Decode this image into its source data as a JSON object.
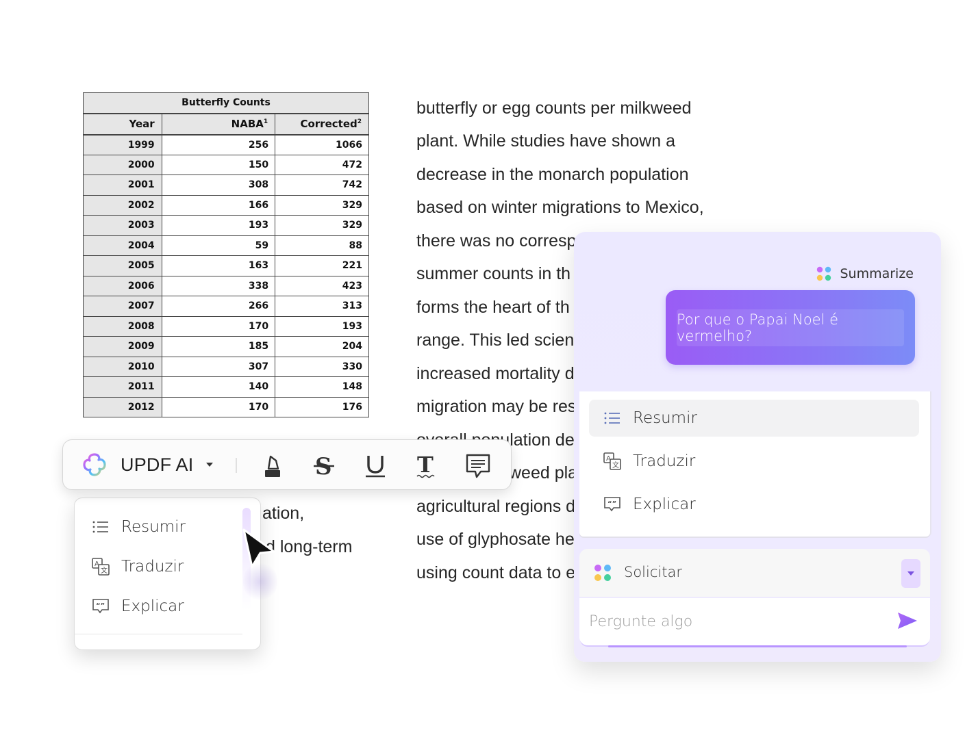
{
  "table": {
    "title": "Butterfly Counts",
    "headers": [
      "Year",
      "NABA",
      "Corrected"
    ],
    "header_sups": [
      "",
      "1",
      "2"
    ],
    "rows": [
      [
        "1999",
        "256",
        "1066"
      ],
      [
        "2000",
        "150",
        "472"
      ],
      [
        "2001",
        "308",
        "742"
      ],
      [
        "2002",
        "166",
        "329"
      ],
      [
        "2003",
        "193",
        "329"
      ],
      [
        "2004",
        "59",
        "88"
      ],
      [
        "2005",
        "163",
        "221"
      ],
      [
        "2006",
        "338",
        "423"
      ],
      [
        "2007",
        "266",
        "313"
      ],
      [
        "2008",
        "170",
        "193"
      ],
      [
        "2009",
        "185",
        "204"
      ],
      [
        "2010",
        "307",
        "330"
      ],
      [
        "2011",
        "140",
        "148"
      ],
      [
        "2012",
        "170",
        "176"
      ]
    ]
  },
  "paragraph": {
    "lines": [
      "butterfly or egg counts per milkweed",
      "plant. While studies have shown a",
      "decrease in the monarch population",
      "based on winter migrations to Mexico,",
      "there was no corresp",
      "summer counts in th",
      "forms the heart of th",
      "range. This led scien",
      "increased mortality d",
      "migration may be res",
      "overall population de",
      "weed pla",
      "agricultural regions d",
      "use of glyphosate he",
      "using count data to e"
    ],
    "fragments": [
      "ation,",
      "d long-term"
    ]
  },
  "toolbar": {
    "brand_label": "UPDF AI",
    "tools": [
      "highlight-tool",
      "strikethrough-tool",
      "underline-tool",
      "text-tool",
      "comment-tool"
    ]
  },
  "mini_menu": {
    "items": [
      {
        "label": "Resumir",
        "icon": "list-icon"
      },
      {
        "label": "Traduzir",
        "icon": "translate-icon"
      },
      {
        "label": "Explicar",
        "icon": "explain-icon"
      }
    ]
  },
  "ai_panel": {
    "summarize_label": "Summarize",
    "prompt": "Por que o Papai Noel é vermelho?",
    "menu_items": [
      {
        "label": "Resumir",
        "icon": "list-icon"
      },
      {
        "label": "Traduzir",
        "icon": "translate-icon"
      },
      {
        "label": "Explicar",
        "icon": "explain-icon"
      }
    ],
    "mode_label": "Solicitar",
    "ask_placeholder": "Pergunte algo"
  },
  "colors": {
    "accent_purple": "#9a5cf5",
    "accent_blue": "#7c8cf7",
    "panel_bg": "#ece9ff",
    "send_icon": "#8a5cf6"
  }
}
